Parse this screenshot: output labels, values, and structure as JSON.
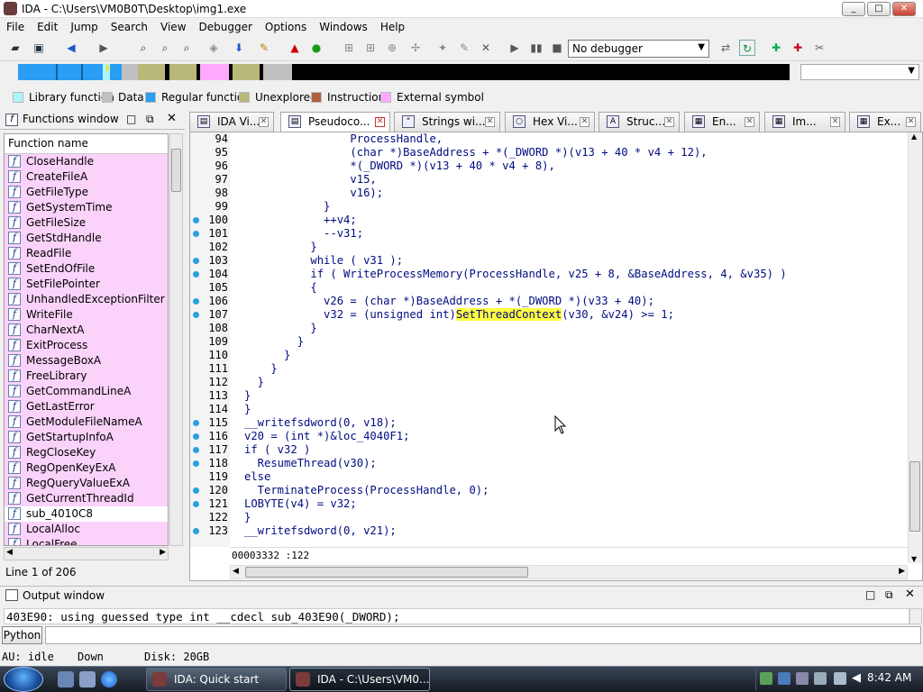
{
  "window": {
    "title": "IDA - C:\\Users\\VM0B0T\\Desktop\\img1.exe",
    "min": "_",
    "max": "□",
    "close": "✕"
  },
  "menu": [
    "File",
    "Edit",
    "Jump",
    "Search",
    "View",
    "Debugger",
    "Options",
    "Windows",
    "Help"
  ],
  "toolbar": {
    "debugger_select": "No debugger"
  },
  "legend": [
    {
      "label": "Library function",
      "color": "#aef4ff"
    },
    {
      "label": "Data",
      "color": "#c0c0c0"
    },
    {
      "label": "Regular function",
      "color": "#2a9df4"
    },
    {
      "label": "Unexplored",
      "color": "#b8b878"
    },
    {
      "label": "Instruction",
      "color": "#b06040"
    },
    {
      "label": "External symbol",
      "color": "#ffaaff"
    }
  ],
  "functions_window": {
    "title": "Functions window",
    "column": "Function name",
    "items": [
      {
        "name": "CloseHandle",
        "ext": true
      },
      {
        "name": "CreateFileA",
        "ext": true
      },
      {
        "name": "GetFileType",
        "ext": true
      },
      {
        "name": "GetSystemTime",
        "ext": true
      },
      {
        "name": "GetFileSize",
        "ext": true
      },
      {
        "name": "GetStdHandle",
        "ext": true
      },
      {
        "name": "ReadFile",
        "ext": true
      },
      {
        "name": "SetEndOfFile",
        "ext": true
      },
      {
        "name": "SetFilePointer",
        "ext": true
      },
      {
        "name": "UnhandledExceptionFilter",
        "ext": true
      },
      {
        "name": "WriteFile",
        "ext": true
      },
      {
        "name": "CharNextA",
        "ext": true
      },
      {
        "name": "ExitProcess",
        "ext": true
      },
      {
        "name": "MessageBoxA",
        "ext": true
      },
      {
        "name": "FreeLibrary",
        "ext": true
      },
      {
        "name": "GetCommandLineA",
        "ext": true
      },
      {
        "name": "GetLastError",
        "ext": true
      },
      {
        "name": "GetModuleFileNameA",
        "ext": true
      },
      {
        "name": "GetStartupInfoA",
        "ext": true
      },
      {
        "name": "RegCloseKey",
        "ext": true
      },
      {
        "name": "RegOpenKeyExA",
        "ext": true
      },
      {
        "name": "RegQueryValueExA",
        "ext": true
      },
      {
        "name": "GetCurrentThreadId",
        "ext": true
      },
      {
        "name": "sub_4010C8",
        "ext": false
      },
      {
        "name": "LocalAlloc",
        "ext": true
      },
      {
        "name": "LocalFree",
        "ext": true
      }
    ],
    "line_info": "Line 1 of 206"
  },
  "tabs": [
    {
      "label": "IDA Vi...",
      "icon": "ida-view-icon",
      "active": false
    },
    {
      "label": "Pseudoco...",
      "icon": "pseudocode-icon",
      "active": true
    },
    {
      "label": "Strings wi...",
      "icon": "strings-icon",
      "active": false
    },
    {
      "label": "Hex Vi...",
      "icon": "hex-view-icon",
      "active": false
    },
    {
      "label": "Struc...",
      "icon": "structures-icon",
      "active": false
    },
    {
      "label": "En...",
      "icon": "enums-icon",
      "active": false
    },
    {
      "label": "Im...",
      "icon": "imports-icon",
      "active": false
    },
    {
      "label": "Ex...",
      "icon": "exports-icon",
      "active": false
    }
  ],
  "code": [
    {
      "n": "94",
      "dot": false,
      "t": "                ProcessHandle,"
    },
    {
      "n": "95",
      "dot": false,
      "t": "                (char *)BaseAddress + *(_DWORD *)(v13 + 40 * v4 + 12),"
    },
    {
      "n": "96",
      "dot": false,
      "t": "                *(_DWORD *)(v13 + 40 * v4 + 8),"
    },
    {
      "n": "97",
      "dot": false,
      "t": "                v15,"
    },
    {
      "n": "98",
      "dot": false,
      "t": "                v16);"
    },
    {
      "n": "99",
      "dot": false,
      "t": "            }"
    },
    {
      "n": "100",
      "dot": true,
      "t": "            ++v4;"
    },
    {
      "n": "101",
      "dot": true,
      "t": "            --v31;"
    },
    {
      "n": "102",
      "dot": false,
      "t": "          }"
    },
    {
      "n": "103",
      "dot": true,
      "t": "          while ( v31 );"
    },
    {
      "n": "104",
      "dot": true,
      "t": "          if ( WriteProcessMemory(ProcessHandle, v25 + 8, &BaseAddress, 4, &v35) )"
    },
    {
      "n": "105",
      "dot": false,
      "t": "          {"
    },
    {
      "n": "106",
      "dot": true,
      "t": "            v26 = (char *)BaseAddress + *(_DWORD *)(v33 + 40);"
    },
    {
      "n": "107",
      "dot": true,
      "t": "            v32 = (unsigned int)SetThreadContext(v30, &v24) >= 1;"
    },
    {
      "n": "108",
      "dot": false,
      "t": "          }"
    },
    {
      "n": "109",
      "dot": false,
      "t": "        }"
    },
    {
      "n": "110",
      "dot": false,
      "t": "      }"
    },
    {
      "n": "111",
      "dot": false,
      "t": "    }"
    },
    {
      "n": "112",
      "dot": false,
      "t": "  }"
    },
    {
      "n": "113",
      "dot": false,
      "t": "}"
    },
    {
      "n": "114",
      "dot": false,
      "t": "}"
    },
    {
      "n": "115",
      "dot": true,
      "t": "__writefsdword(0, v18);"
    },
    {
      "n": "116",
      "dot": true,
      "t": "v20 = (int *)&loc_4040F1;"
    },
    {
      "n": "117",
      "dot": true,
      "t": "if ( v32 )"
    },
    {
      "n": "118",
      "dot": true,
      "t": "  ResumeThread(v30);"
    },
    {
      "n": "119",
      "dot": false,
      "t": "else"
    },
    {
      "n": "120",
      "dot": true,
      "t": "  TerminateProcess(ProcessHandle, 0);"
    },
    {
      "n": "121",
      "dot": true,
      "t": "LOBYTE(v4) = v32;"
    },
    {
      "n": "122",
      "dot": false,
      "t": "}"
    },
    {
      "n": "123",
      "dot": true,
      "t": "__writefsdword(0, v21);"
    }
  ],
  "address_bar": "00003332 :122",
  "output_window": {
    "title": "Output window",
    "text": "403E90: using guessed type int __cdecl sub_403E90(_DWORD);",
    "python_button": "Python"
  },
  "status": {
    "au": "AU:  idle",
    "down": "Down",
    "disk": "Disk: 20GB"
  },
  "taskbar": {
    "tasks": [
      {
        "label": "IDA: Quick start",
        "active": false
      },
      {
        "label": "IDA - C:\\Users\\VM0...",
        "active": true
      }
    ],
    "clock": "8:42 AM"
  }
}
